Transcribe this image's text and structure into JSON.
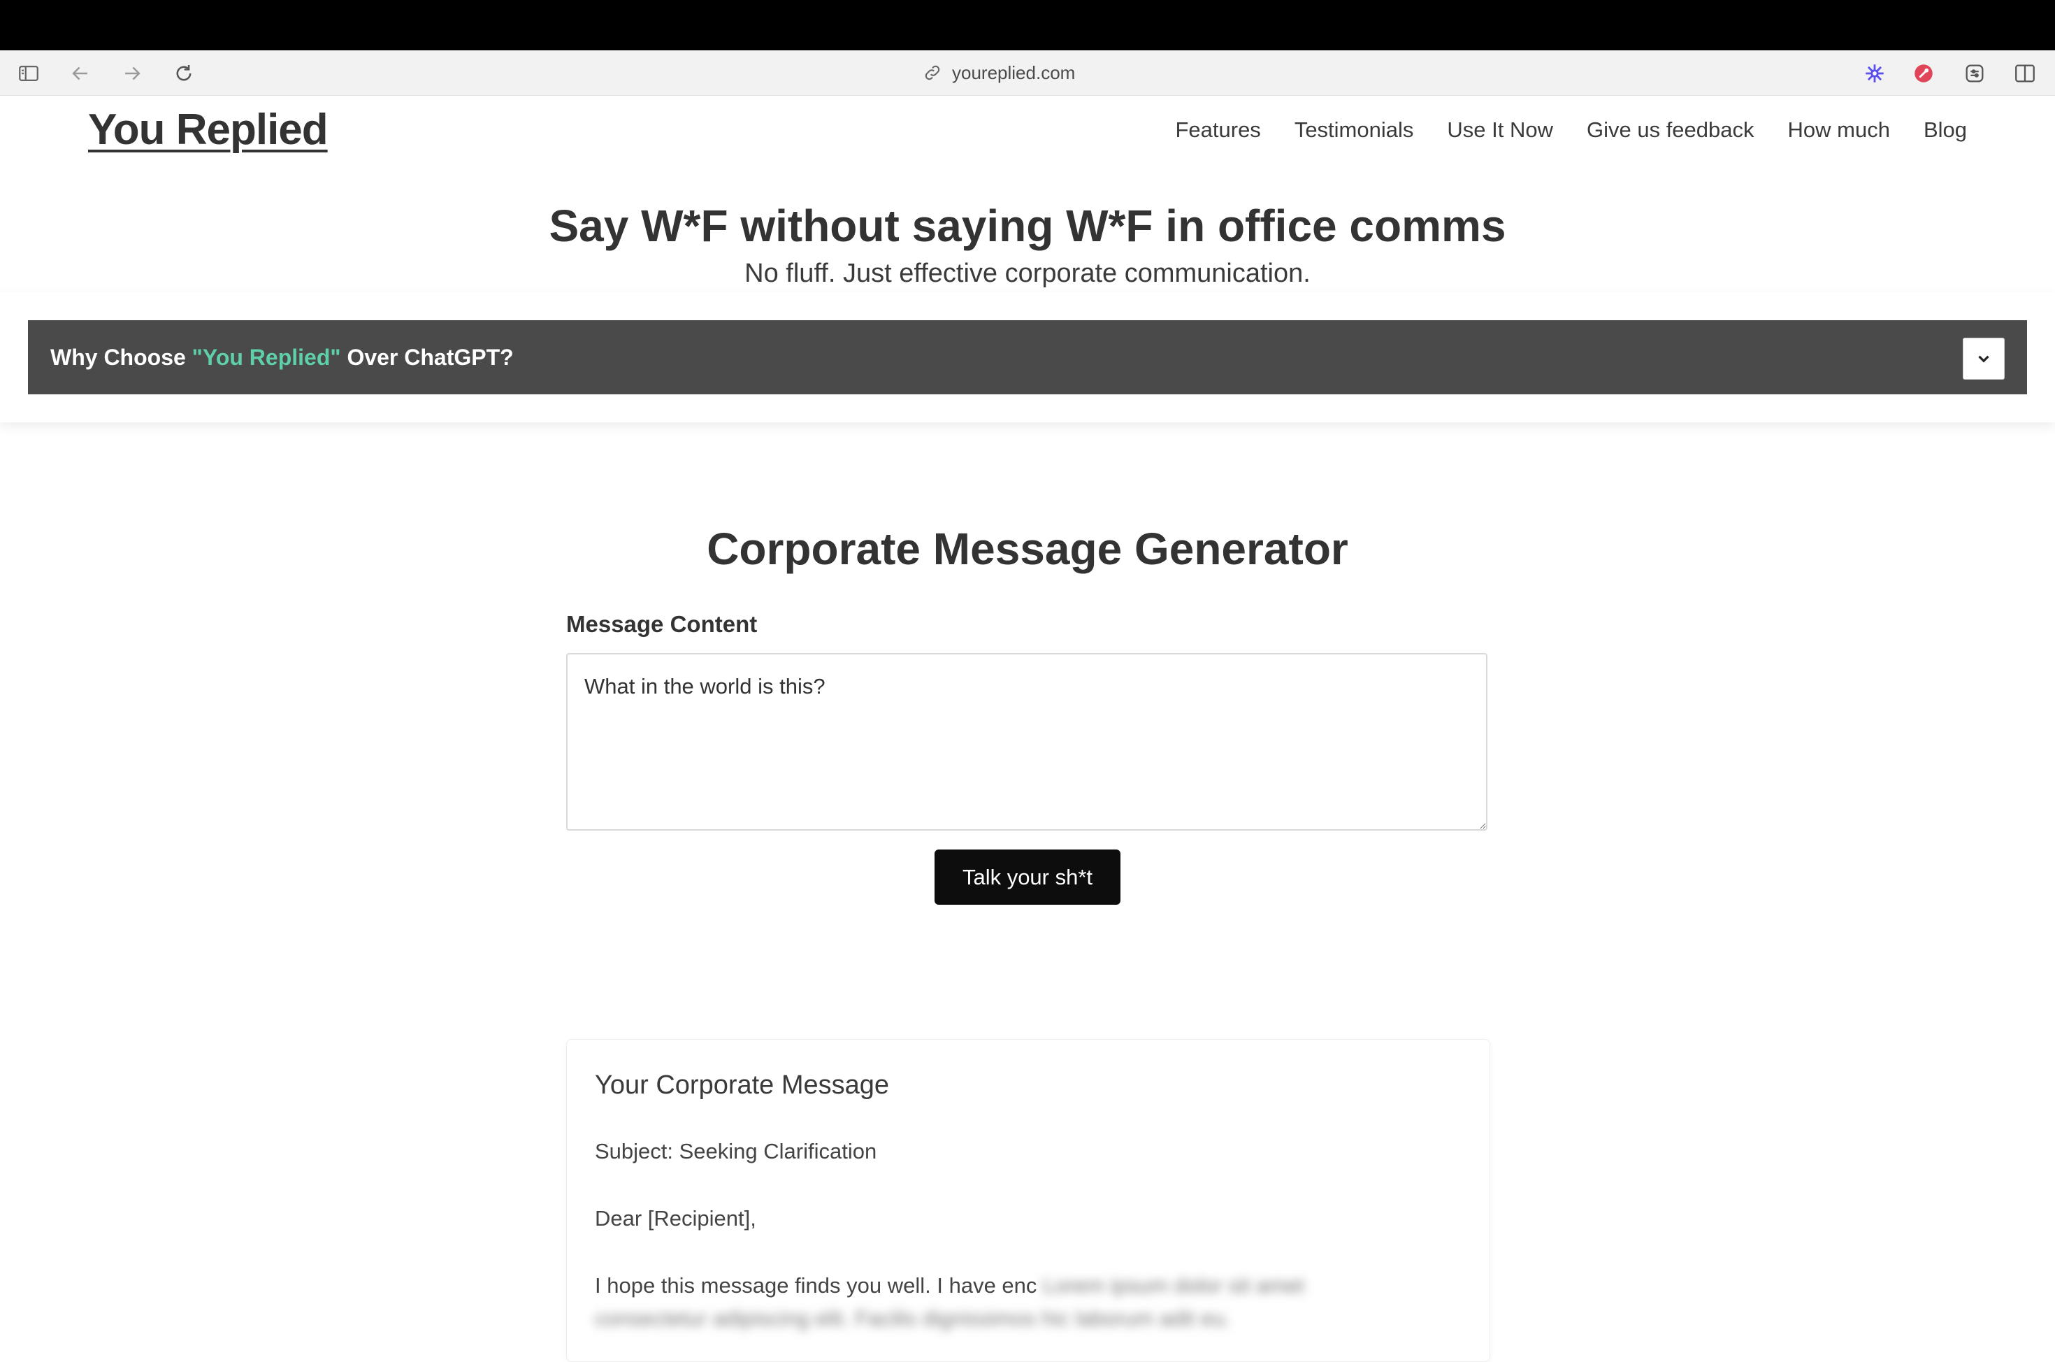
{
  "browser": {
    "url": "youreplied.com"
  },
  "site": {
    "logo": "You Replied",
    "nav": [
      "Features",
      "Testimonials",
      "Use It Now",
      "Give us feedback",
      "How much",
      "Blog"
    ]
  },
  "hero": {
    "title": "Say W*F without saying W*F in office comms",
    "subtitle": "No fluff. Just effective corporate communication."
  },
  "why": {
    "prefix": "Why Choose ",
    "accent": "\"You Replied\"",
    "suffix": " Over ChatGPT?",
    "accent_color": "#5ecfa8"
  },
  "generator": {
    "title": "Corporate Message Generator",
    "field_label": "Message Content",
    "input_value": "What in the world is this?",
    "button_label": "Talk your sh*t"
  },
  "result": {
    "title": "Your Corporate Message",
    "subject": "Subject: Seeking Clarification",
    "greeting": "Dear [Recipient],",
    "body_visible": "I hope this message finds you well. I have enc",
    "body_blurred_1": "Lorem ipsum dolor sit amet",
    "body_blurred_2": "consectetur adipiscing elit. Facilis dignissimos hic laborum adit eu."
  },
  "icons": {
    "sidebar": "sidebar-icon",
    "back": "back-arrow-icon",
    "forward": "forward-arrow-icon",
    "reload": "reload-icon",
    "link": "link-icon",
    "ext1": "sparkle-extension-icon",
    "ext2": "red-extension-icon",
    "ext3": "settings-extension-icon",
    "split": "split-view-icon",
    "chevron": "chevron-down-icon"
  }
}
